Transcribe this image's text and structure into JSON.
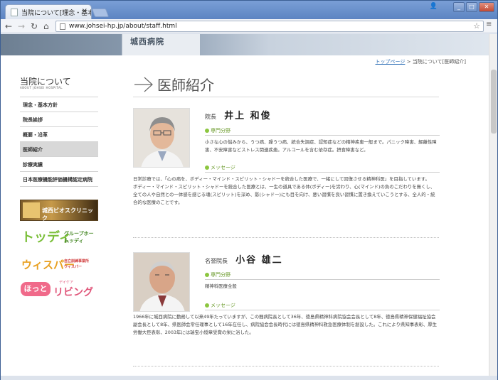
{
  "browser": {
    "tab_title": "当院について[理念・基本方",
    "tab_close": "×",
    "url": "www.johsei-hp.jp/about/staff.html",
    "window_buttons": [
      "_",
      "□",
      "✕"
    ],
    "user_icon": "👤"
  },
  "hero": {
    "sign": "城西病院"
  },
  "breadcrumb": {
    "home": "トップページ",
    "separator": " > ",
    "current": "当院について[医師紹介]"
  },
  "sidebar": {
    "title": "当院について",
    "subtitle": "ABOUT JOHSEI HOSPITAL",
    "items": [
      {
        "label": "理念・基本方針",
        "active": false
      },
      {
        "label": "院長挨拶",
        "active": false
      },
      {
        "label": "概要・沿革",
        "active": false
      },
      {
        "label": "医師紹介",
        "active": true
      },
      {
        "label": "診療実績",
        "active": false
      },
      {
        "label": "日本医療機能評価機構認定病院",
        "active": false
      }
    ],
    "banners": {
      "clinic": "城西ビオスクリニック",
      "group_home_logo": "トッディ",
      "group_home_line1": "グループホーム",
      "group_home_line2": "トッディ",
      "wisper_logo": "ウィスパー",
      "wisper_line1": "自立訓練事業所",
      "wisper_line2": "ウィスパー",
      "living_pill": "ほっと",
      "living_small": "デイケア",
      "living_big": "リビング"
    }
  },
  "main": {
    "heading": "医師紹介",
    "doctors": [
      {
        "role": "院長",
        "name": "井上 和俊",
        "specialty_label": "専門分野",
        "specialty_text": "小さな心の悩みから、うつ病、躁うつ病、統合失調症、認知症などの精神疾患一般まで。パニック障害、解離性障害、不安障害などストレス関連疾患。アルコールを含む依存症。摂食障害など。",
        "message_label": "メッセージ",
        "message_text_1": "日常診療では、「心の病を、ボディー・マインド・スピリット・シャドーを統合した医療で、一緒にして回復させる精神科医」を目指しています。",
        "message_text_2": "ボディー・マインド・スピリット・シャドーを統合した医療とは、一生の道具である体(ボディー)を労わり、心(マインド)の負のこだわりを無くし、全ての人や自然との一体感を感じる魂(スピリット)を深め、影(シャドー)にも目を向け、悪い習慣を良い習慣に置き換えていこうとする、全人的・統合的な医療のことです。"
      },
      {
        "role": "名誉院長",
        "name": "小谷 雄二",
        "specialty_label": "専門分野",
        "specialty_text": "精神科医療全般",
        "message_label": "メッセージ",
        "message_text_1": "1966年に城西病院に勤務して以来49年たっていますが、この間病院長として36年、徳島県精神科病院協会会長として8年、徳島県精神保健福祉協会副会長として8年、県医師会常任理事として16年在任し、病院協会会長時代には徳島県精神科救急医療体制を創設した。これにより県知事表彰、厚生労働大臣表彰、2003年には瑞宝小綬章受賞の栄に浴した。",
        "message_text_2": ""
      }
    ]
  },
  "colors": {
    "accent_green": "#8cc63f",
    "link_blue": "#2f6fb6",
    "active_nav_bg": "#d8d8d8"
  }
}
